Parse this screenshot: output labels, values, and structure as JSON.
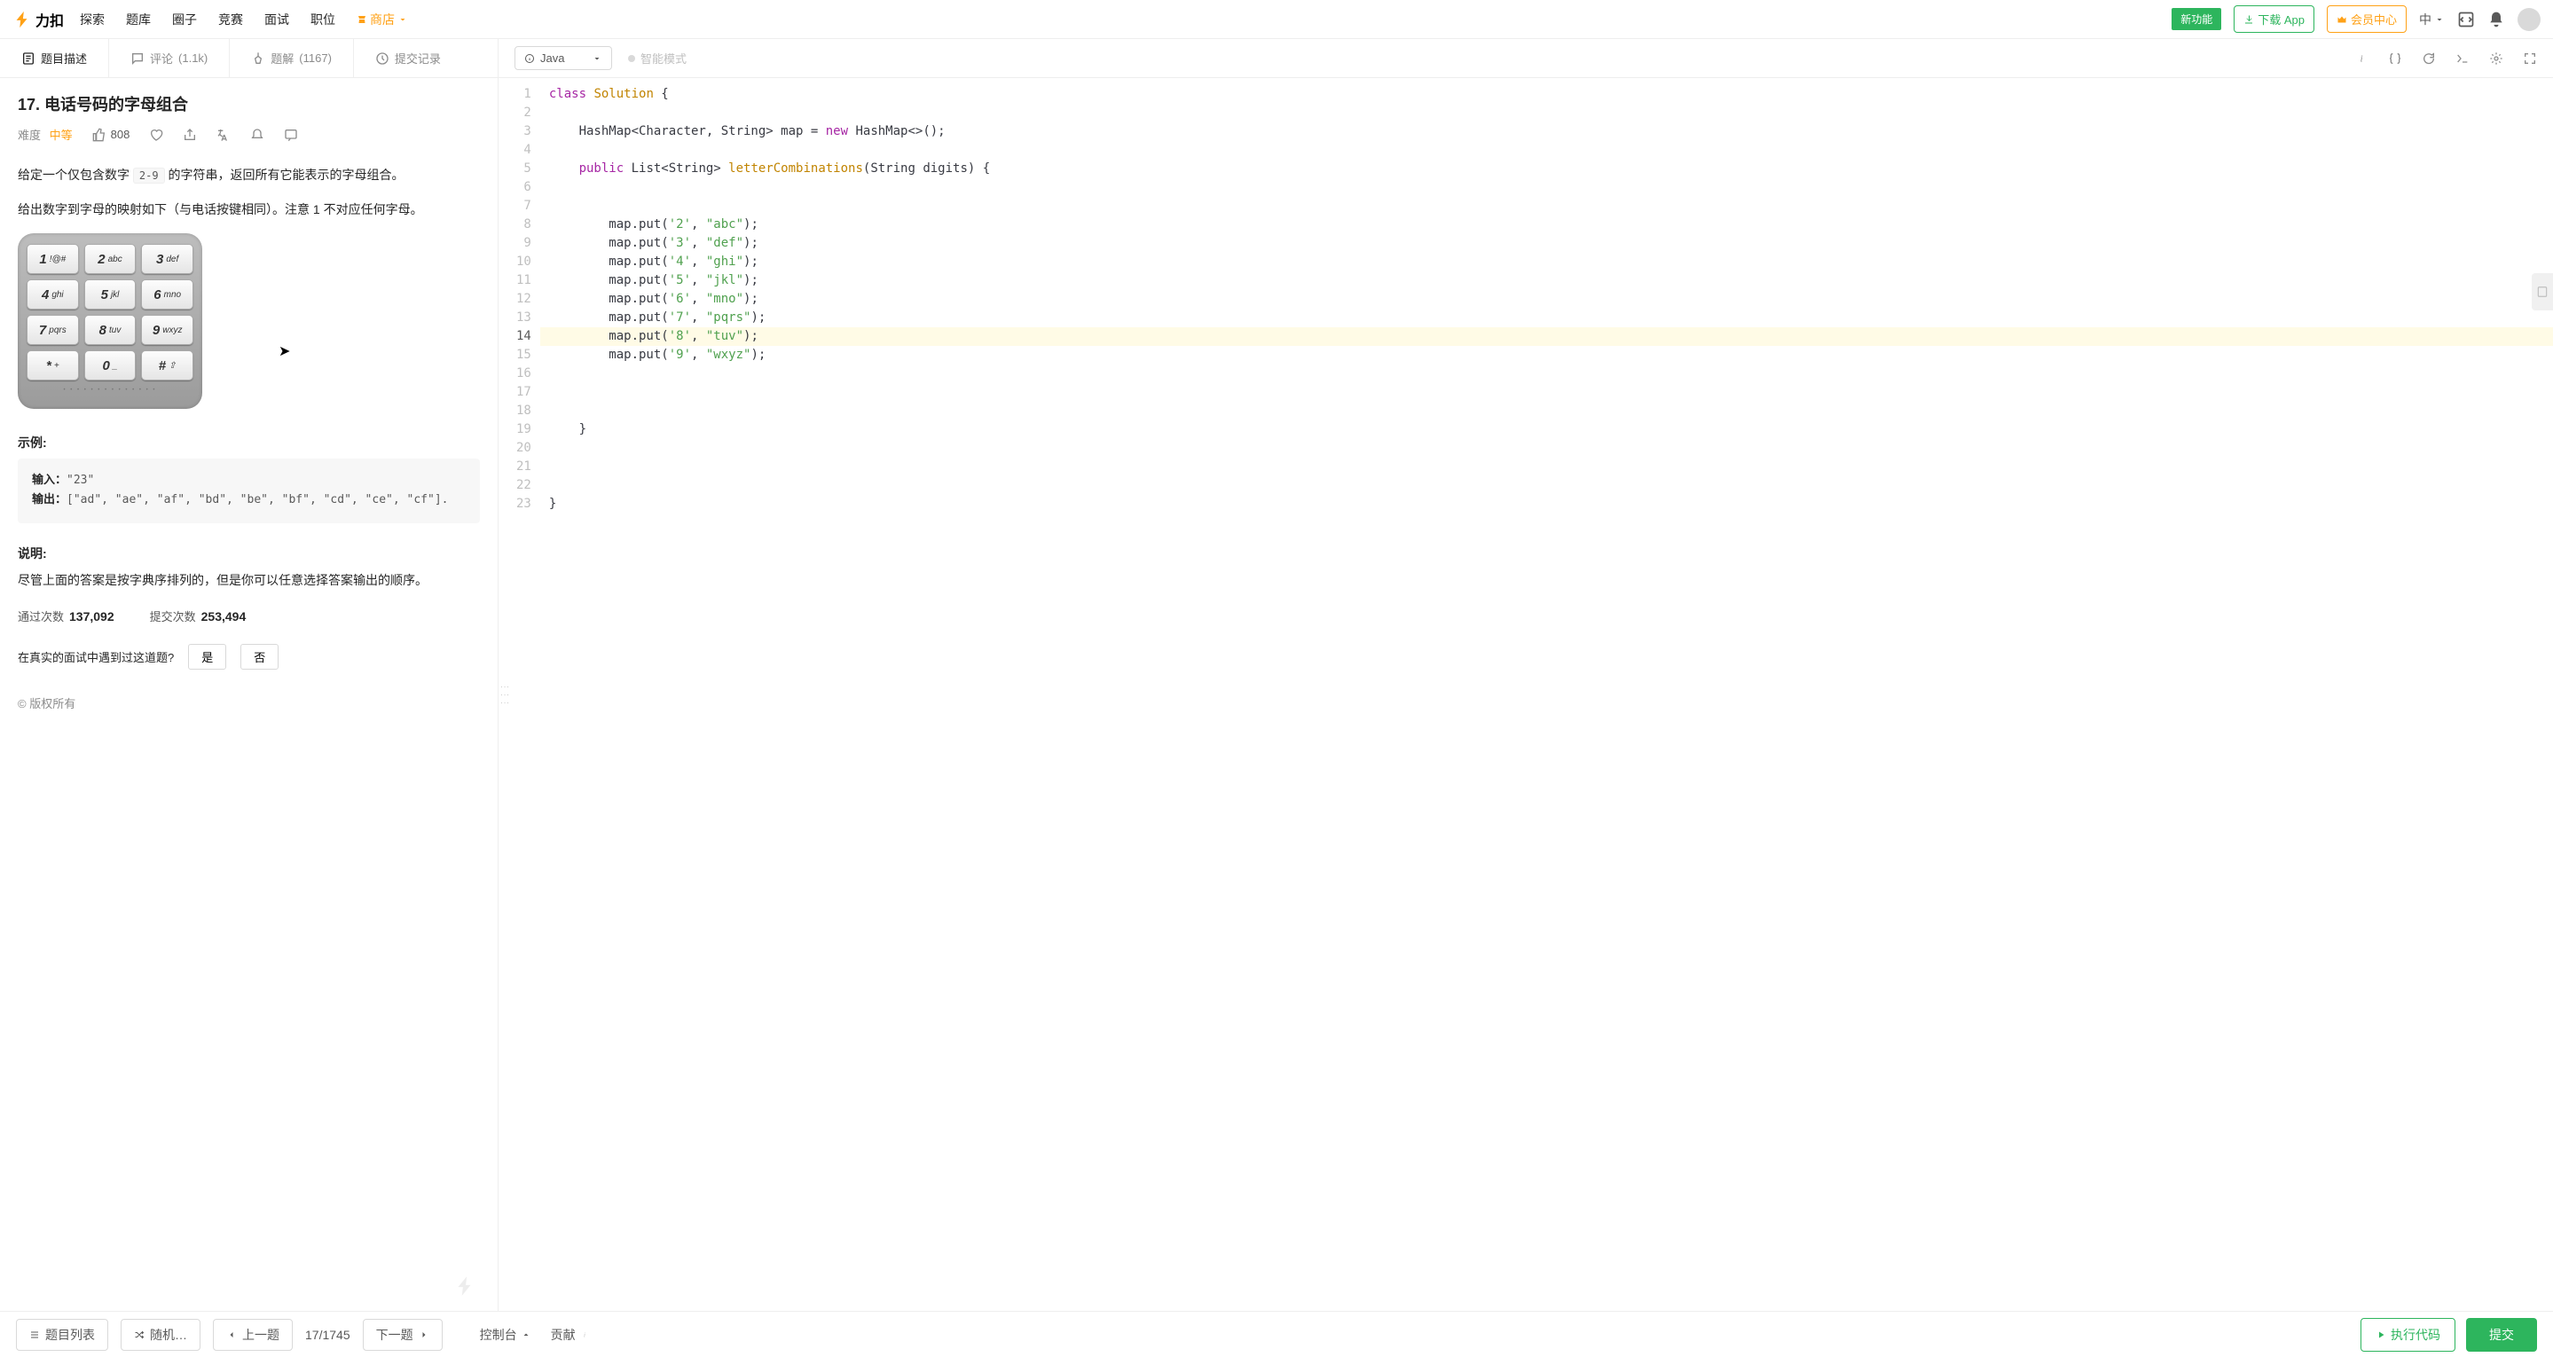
{
  "nav": {
    "brand": "力扣",
    "links": [
      "探索",
      "题库",
      "圈子",
      "竞赛",
      "面试",
      "职位"
    ],
    "shop": "商店",
    "new_badge": "新功能",
    "download": "下载 App",
    "vip": "会员中心",
    "lang": "中"
  },
  "tabs": {
    "description": "题目描述",
    "comments_label": "评论",
    "comments_count": "(1.1k)",
    "solutions_label": "题解",
    "solutions_count": "(1167)",
    "submissions": "提交记录"
  },
  "problem": {
    "title": "17. 电话号码的字母组合",
    "difficulty_label": "难度",
    "difficulty_value": "中等",
    "likes": "808",
    "para1_a": "给定一个仅包含数字 ",
    "para1_code": "2-9",
    "para1_b": " 的字符串，返回所有它能表示的字母组合。",
    "para2": "给出数字到字母的映射如下（与电话按键相同）。注意 1 不对应任何字母。",
    "keypad": [
      {
        "num": "1",
        "letters": "!@#"
      },
      {
        "num": "2",
        "letters": "abc"
      },
      {
        "num": "3",
        "letters": "def"
      },
      {
        "num": "4",
        "letters": "ghi"
      },
      {
        "num": "5",
        "letters": "jkl"
      },
      {
        "num": "6",
        "letters": "mno"
      },
      {
        "num": "7",
        "letters": "pqrs"
      },
      {
        "num": "8",
        "letters": "tuv"
      },
      {
        "num": "9",
        "letters": "wxyz"
      },
      {
        "num": "*",
        "letters": "+"
      },
      {
        "num": "0",
        "letters": "_"
      },
      {
        "num": "#",
        "letters": "⇧"
      }
    ],
    "example_header": "示例:",
    "example_input_label": "输入：",
    "example_input": "\"23\"",
    "example_output_label": "输出：",
    "example_output": "[\"ad\", \"ae\", \"af\", \"bd\", \"be\", \"bf\", \"cd\", \"ce\", \"cf\"].",
    "note_header": "说明:",
    "note_body": "尽管上面的答案是按字典序排列的，但是你可以任意选择答案输出的顺序。",
    "accepted_label": "通过次数",
    "accepted_value": "137,092",
    "submissions_label": "提交次数",
    "submissions_value": "253,494",
    "interview_q": "在真实的面试中遇到过这道题?",
    "yes": "是",
    "no": "否",
    "copyright": "© 版权所有"
  },
  "editor": {
    "language": "Java",
    "smart_mode": "智能模式",
    "line_count": 23,
    "highlight_line": 14,
    "code_tokens": [
      [
        [
          "kw",
          "class "
        ],
        [
          "type",
          "Solution"
        ],
        [
          "op",
          " {"
        ]
      ],
      [],
      [
        [
          "op",
          "    HashMap<Character, String> map = "
        ],
        [
          "new",
          "new"
        ],
        [
          "op",
          " HashMap<>();"
        ]
      ],
      [],
      [
        [
          "op",
          "    "
        ],
        [
          "kw",
          "public"
        ],
        [
          "op",
          " List<String> "
        ],
        [
          "type",
          "letterCombinations"
        ],
        [
          "op",
          "(String digits) {"
        ]
      ],
      [],
      [],
      [
        [
          "op",
          "        map.put("
        ],
        [
          "chr",
          "'2'"
        ],
        [
          "op",
          ", "
        ],
        [
          "str",
          "\"abc\""
        ],
        [
          "op",
          ");"
        ]
      ],
      [
        [
          "op",
          "        map.put("
        ],
        [
          "chr",
          "'3'"
        ],
        [
          "op",
          ", "
        ],
        [
          "str",
          "\"def\""
        ],
        [
          "op",
          ");"
        ]
      ],
      [
        [
          "op",
          "        map.put("
        ],
        [
          "chr",
          "'4'"
        ],
        [
          "op",
          ", "
        ],
        [
          "str",
          "\"ghi\""
        ],
        [
          "op",
          ");"
        ]
      ],
      [
        [
          "op",
          "        map.put("
        ],
        [
          "chr",
          "'5'"
        ],
        [
          "op",
          ", "
        ],
        [
          "str",
          "\"jkl\""
        ],
        [
          "op",
          ");"
        ]
      ],
      [
        [
          "op",
          "        map.put("
        ],
        [
          "chr",
          "'6'"
        ],
        [
          "op",
          ", "
        ],
        [
          "str",
          "\"mno\""
        ],
        [
          "op",
          ");"
        ]
      ],
      [
        [
          "op",
          "        map.put("
        ],
        [
          "chr",
          "'7'"
        ],
        [
          "op",
          ", "
        ],
        [
          "str",
          "\"pqrs\""
        ],
        [
          "op",
          ");"
        ]
      ],
      [
        [
          "op",
          "        map.put("
        ],
        [
          "chr",
          "'8'"
        ],
        [
          "op",
          ", "
        ],
        [
          "str",
          "\"tuv\""
        ],
        [
          "op",
          ");"
        ]
      ],
      [
        [
          "op",
          "        map.put("
        ],
        [
          "chr",
          "'9'"
        ],
        [
          "op",
          ", "
        ],
        [
          "str",
          "\"wxyz\""
        ],
        [
          "op",
          ");"
        ]
      ],
      [],
      [],
      [],
      [
        [
          "op",
          "    }"
        ]
      ],
      [],
      [],
      [],
      [
        [
          "op",
          "}"
        ]
      ]
    ]
  },
  "bottom": {
    "list": "题目列表",
    "random": "随机…",
    "prev": "上一题",
    "counter": "17/1745",
    "next": "下一题",
    "console": "控制台",
    "contribute": "贡献",
    "run": "执行代码",
    "submit": "提交"
  }
}
